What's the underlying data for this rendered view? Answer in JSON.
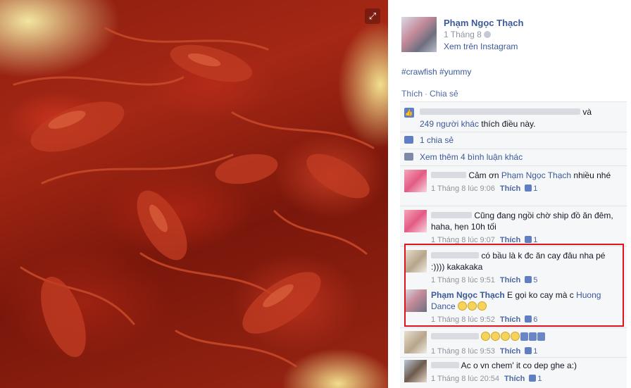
{
  "photo": {
    "expand_icon": "expand-icon",
    "colors": {
      "crawfish": "#a82313",
      "bag": "#f2df8e"
    }
  },
  "post": {
    "author": "Phạm Ngọc Thạch",
    "date": "1 Tháng 8",
    "view_on_instagram": "Xem trên Instagram",
    "caption": "#crawfish #yummy",
    "actions": {
      "like": "Thích",
      "separator": "·",
      "share": "Chia sẻ"
    },
    "likes_line1_end": "và",
    "likes_others": "249 người khác",
    "likes_suffix": "thích điều này.",
    "shares": "1 chia sẻ",
    "more_comments": "Xem thêm 4 bình luận khác"
  },
  "comments": [
    {
      "author": "",
      "text_link_prefix": "Cảm ơn",
      "mention": "Phạm Ngọc Thạch",
      "text": "nhiều nhé",
      "time": "1 Tháng 8 lúc 9:06",
      "like": "Thích",
      "count": "1"
    },
    {
      "author": "",
      "text": "Cũng đang ngồi chờ ship đồ ăn đêm, haha, hẹn 10h tối",
      "time": "1 Tháng 8 lúc 9:07",
      "like": "Thích",
      "count": "1"
    },
    {
      "author": "",
      "text": "có bầu là k đc ăn cay đâu nha pé :)))) kakakaka",
      "time": "1 Tháng 8 lúc 9:51",
      "like": "Thích",
      "count": "5"
    },
    {
      "author": "Phạm Ngọc Thạch",
      "text": "E gọi ko cay mà c",
      "mention": "Huong Dance",
      "time": "1 Tháng 8 lúc 9:52",
      "like": "Thích",
      "count": "6"
    },
    {
      "author": "",
      "text": "",
      "time": "1 Tháng 8 lúc 9:53",
      "like": "Thích",
      "count": "1"
    },
    {
      "author": "",
      "text": "Ac o vn chem' it co dep ghe a:)",
      "time": "1 Tháng 8 lúc 20:54",
      "like": "Thích",
      "count": "1"
    }
  ],
  "highlight_color": "#e0141e",
  "link_color": "#3b5998"
}
